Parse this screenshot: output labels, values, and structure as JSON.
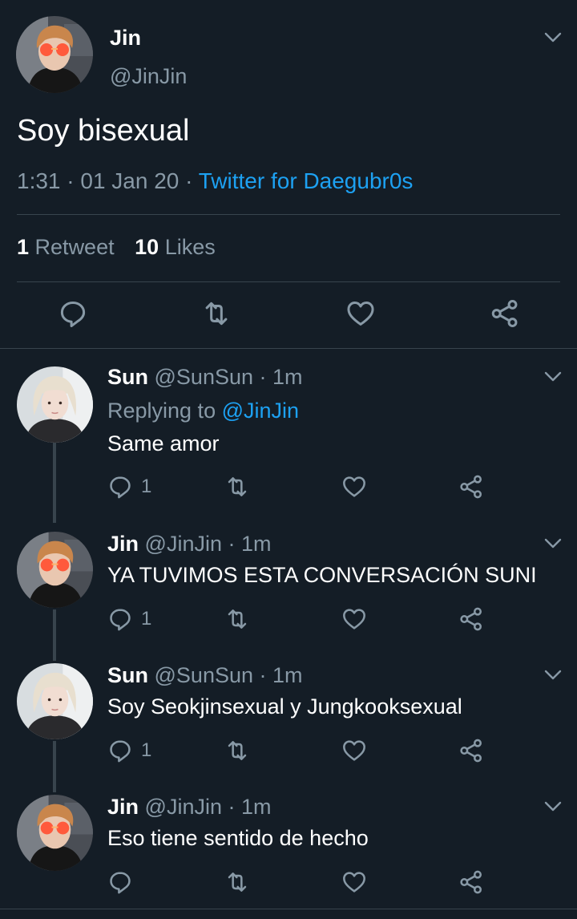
{
  "main_tweet": {
    "name": "Jin",
    "handle": "@JinJin",
    "text": "Soy bisexual",
    "time": "1:31 · 01 Jan 20 · ",
    "source": "Twitter for Daegubr0s",
    "retweets_count": "1",
    "retweets_label": "Retweet",
    "likes_count": "10",
    "likes_label": "Likes"
  },
  "replies": [
    {
      "name": "Sun",
      "meta": "@SunSun · 1m",
      "replying_prefix": "Replying to ",
      "replying_handle": "@JinJin",
      "text": "Same amor",
      "reply_count": "1"
    },
    {
      "name": "Jin",
      "meta": "@JinJin · 1m",
      "text": "YA TUVIMOS ESTA CONVERSACIÓN SUNI",
      "reply_count": "1"
    },
    {
      "name": "Sun",
      "meta": "@SunSun · 1m",
      "text": "Soy Seokjinsexual y Jungkooksexual",
      "reply_count": "1"
    },
    {
      "name": "Jin",
      "meta": "@JinJin · 1m",
      "text": "Eso tiene sentido de hecho",
      "reply_count": ""
    }
  ],
  "colors": {
    "background": "#141d26",
    "accent": "#1da1f2",
    "muted": "#8899a6",
    "divider": "#38444d"
  },
  "icons": [
    "chevron-down-icon",
    "reply-icon",
    "retweet-icon",
    "like-icon",
    "share-icon"
  ]
}
